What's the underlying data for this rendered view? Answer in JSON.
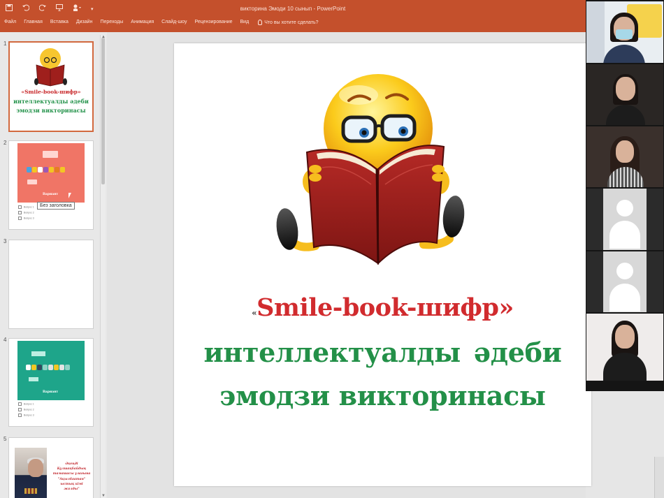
{
  "window": {
    "title": "викторина Эмоди 10 сынып - PowerPoint",
    "quick_access": {
      "save_icon": "save-icon",
      "undo_icon": "undo-icon",
      "redo_icon": "redo-icon",
      "present_icon": "present-icon",
      "touch_icon": "touch-mode-icon",
      "more": "▾"
    }
  },
  "ribbon": {
    "tabs": [
      "Файл",
      "Главная",
      "Вставка",
      "Дизайн",
      "Переходы",
      "Анимация",
      "Слайд-шоу",
      "Рецензирование",
      "Вид"
    ],
    "tell_me": "Что вы хотите сделать?"
  },
  "thumbnails": {
    "slides": [
      {
        "number": "1",
        "line1": "«Smile-book-шифр»",
        "line2": "интеллектуалды әдеби",
        "line3": "эмодзи викторинасы"
      },
      {
        "number": "2",
        "label": "Вариант",
        "tooltip": "Без заголовка",
        "options": [
          "Вопрос 1",
          "Вопрос 2",
          "Вопрос 3"
        ]
      },
      {
        "number": "3"
      },
      {
        "number": "4",
        "label": "Вариант",
        "options": [
          "Вопрос 1",
          "Вопрос 2",
          "Вопрос 3"
        ]
      },
      {
        "number": "5",
        "text": "Әкеңді Құлшақбайдың тамашасы ұлағына \"Ақылбаатан\" ыстық кімі жалды\""
      }
    ]
  },
  "slide": {
    "quote_open": "«",
    "line1": "Smile-book-шифр",
    "quote_close": "»",
    "line2": "интеллектуалды  әдеби",
    "line3": "эмодзи викторинасы"
  },
  "video": {
    "participants": [
      "participant-1",
      "participant-2",
      "participant-3",
      "participant-4",
      "participant-5",
      "participant-6"
    ]
  },
  "colors": {
    "ribbon": "#c4502c",
    "title_red": "#d12b2e",
    "title_green": "#239048"
  }
}
